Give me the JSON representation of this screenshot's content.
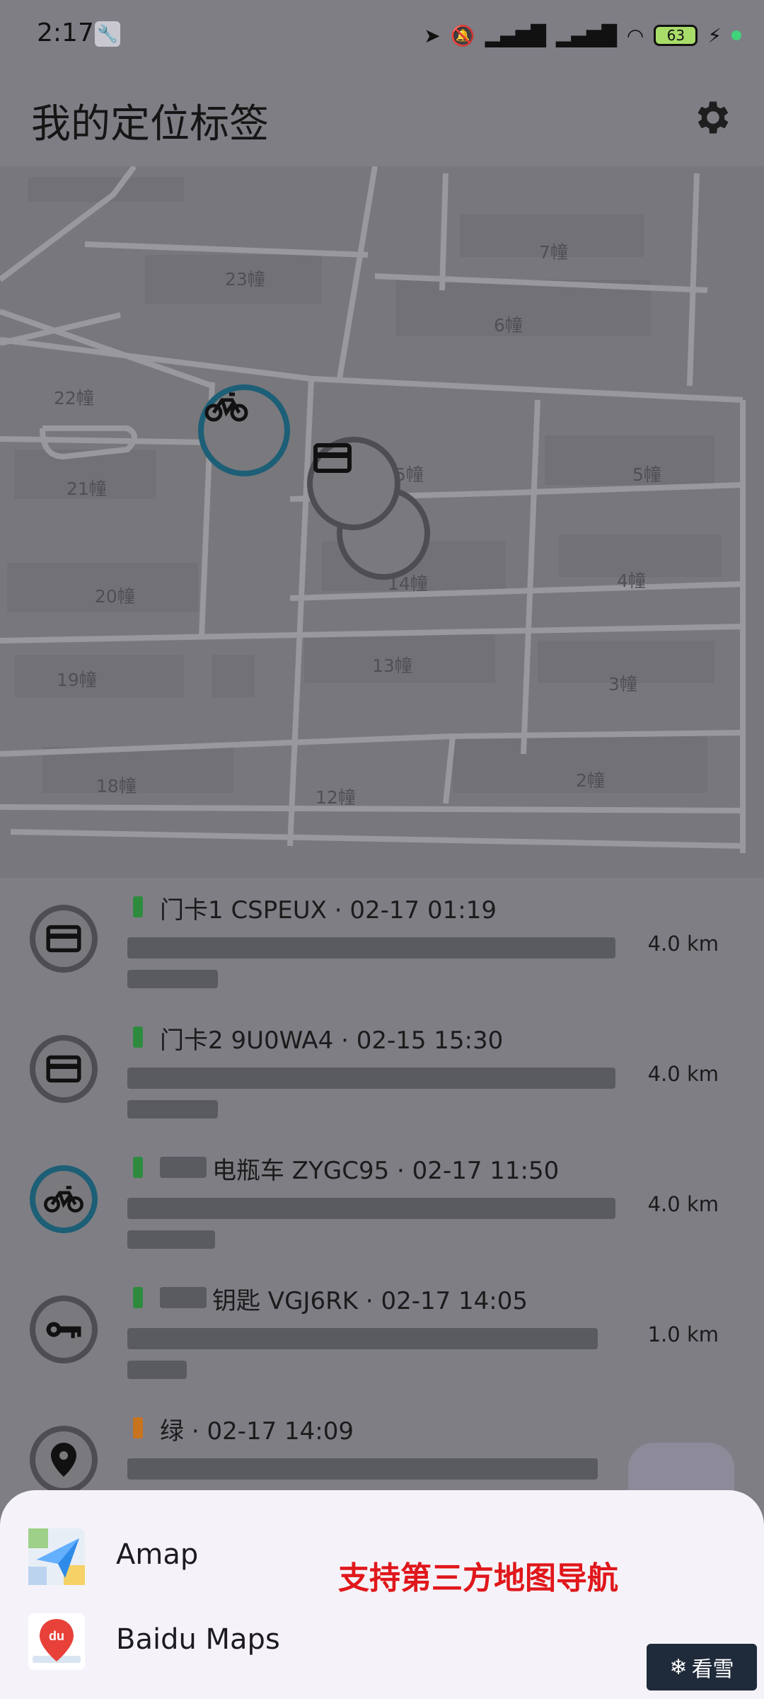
{
  "status_bar": {
    "time": "2:17",
    "battery": "63"
  },
  "app_bar": {
    "title": "我的定位标签"
  },
  "map": {
    "buildings": [
      {
        "label": "7幢"
      },
      {
        "label": "23幢"
      },
      {
        "label": "6幢"
      },
      {
        "label": "22幢"
      },
      {
        "label": "21幢"
      },
      {
        "label": "5幢"
      },
      {
        "label": "5幢"
      },
      {
        "label": "14幢"
      },
      {
        "label": "4幢"
      },
      {
        "label": "20幢"
      },
      {
        "label": "13幢"
      },
      {
        "label": "19幢"
      },
      {
        "label": "3幢"
      },
      {
        "label": "18幢"
      },
      {
        "label": "12幢"
      },
      {
        "label": "2幢"
      }
    ]
  },
  "tags": [
    {
      "name": "门卡1 CSPEUX",
      "time": "02-17 01:19",
      "distance": "4.0 km",
      "icon": "card-icon",
      "battery_color": "#2e8b3e"
    },
    {
      "name": "门卡2 9U0WA4",
      "time": "02-15 15:30",
      "distance": "4.0 km",
      "icon": "card-icon",
      "battery_color": "#2e8b3e"
    },
    {
      "name": "电瓶车 ZYGC95",
      "time": "02-17 11:50",
      "distance": "4.0 km",
      "icon": "bike-icon",
      "battery_color": "#2e8b3e"
    },
    {
      "name": "钥匙 VGJ6RK",
      "time": "02-17 14:05",
      "distance": "1.0 km",
      "icon": "key-icon",
      "battery_color": "#2e8b3e"
    },
    {
      "name": "绿",
      "time": "02-17 14:09",
      "distance": "",
      "icon": "location-pin-icon",
      "battery_color": "#c8741f"
    }
  ],
  "separator": "·",
  "sheet": {
    "options": [
      {
        "label": "Amap",
        "icon": "amap-icon"
      },
      {
        "label": "Baidu Maps",
        "icon": "baidu-maps-icon"
      }
    ],
    "promo_text": "支持第三方地图导航"
  },
  "watermark": {
    "text": "看雪"
  }
}
